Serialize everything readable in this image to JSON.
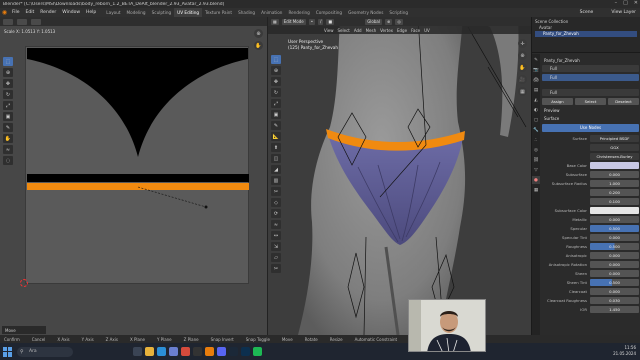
{
  "titlebar": {
    "title": "Blender* [C:\\Users\\MSI\\Downloads\\body_reborn_1.2_BETA_DeAlt_blender_2.93_Avatar_2.93.blend]"
  },
  "menubar": {
    "items": [
      "File",
      "Edit",
      "Render",
      "Window",
      "Help"
    ],
    "workspaces": [
      "Layout",
      "Modeling",
      "Sculpting",
      "UV Editing",
      "Texture Paint",
      "Shading",
      "Animation",
      "Rendering",
      "Compositing",
      "Geometry Nodes",
      "Scripting"
    ],
    "active_workspace": "UV Editing",
    "scene": "Scene",
    "view_layer": "View Layer"
  },
  "uv_editor": {
    "scale_text": "Scale X: 1.0513",
    "scale_y_text": "Y: 1.0513",
    "status_text": "Move"
  },
  "viewport": {
    "mode": "Edit Mode",
    "header_items": [
      "View",
      "Select",
      "Add",
      "Mesh",
      "Vertex",
      "Edge",
      "Face",
      "UV"
    ],
    "transform": "Global",
    "view_name": "User Perspective",
    "object_name": "(125) Panty_for_Zhevah"
  },
  "outliner": {
    "rows": [
      "Scene Collection",
      "Avatar",
      "Panty_for_Zhevah"
    ],
    "selected_row": 2
  },
  "properties": {
    "object_name": "Panty_for_Zhevah",
    "material_slot": "Full",
    "material_name": "Full",
    "buttons": [
      "Assign",
      "Select",
      "Deselect"
    ],
    "preview_label": "Preview",
    "surface_label": "Surface",
    "use_nodes_label": "Use Nodes",
    "surface_shader": "Principled BSDF",
    "distribution": "GGX",
    "subsurface_method": "Christensen-Burley",
    "rows": [
      {
        "label": "Base Color",
        "value": "",
        "style": "color"
      },
      {
        "label": "Subsurface",
        "value": "0.000",
        "style": ""
      },
      {
        "label": "Subsurface Radius",
        "value": "1.000",
        "style": ""
      },
      {
        "label": "",
        "value": "0.200",
        "style": ""
      },
      {
        "label": "",
        "value": "0.100",
        "style": ""
      },
      {
        "label": "Subsurface Color",
        "value": "",
        "style": "white"
      },
      {
        "label": "Metallic",
        "value": "0.000",
        "style": ""
      },
      {
        "label": "Specular",
        "value": "0.500",
        "style": "blue"
      },
      {
        "label": "Specular Tint",
        "value": "0.000",
        "style": ""
      },
      {
        "label": "Roughness",
        "value": "0.500",
        "style": "half"
      },
      {
        "label": "Anisotropic",
        "value": "0.000",
        "style": ""
      },
      {
        "label": "Anisotropic Rotation",
        "value": "0.000",
        "style": ""
      },
      {
        "label": "Sheen",
        "value": "0.000",
        "style": ""
      },
      {
        "label": "Sheen Tint",
        "value": "0.500",
        "style": "q"
      },
      {
        "label": "Clearcoat",
        "value": "0.000",
        "style": ""
      },
      {
        "label": "Clearcoat Roughness",
        "value": "0.030",
        "style": ""
      },
      {
        "label": "IOR",
        "value": "1.450",
        "style": ""
      }
    ]
  },
  "statusbar": {
    "items": [
      "Confirm",
      "Cancel",
      "X Axis",
      "Y Axis",
      "Z Axis",
      "X Plane",
      "Y Plane",
      "Z Plane",
      "Snap Invert",
      "Snap Toggle",
      "Move",
      "Rotate",
      "Resize",
      "Automatic Constraint"
    ]
  },
  "taskbar": {
    "search_placeholder": "Ara",
    "time": "11:56",
    "date": "21.05.2024"
  },
  "colors": {
    "accent_blue": "#4772b3",
    "waistband_orange": "#f08a10",
    "uv_background": "#5a5a5a",
    "garment_purple": "#7470a6"
  }
}
